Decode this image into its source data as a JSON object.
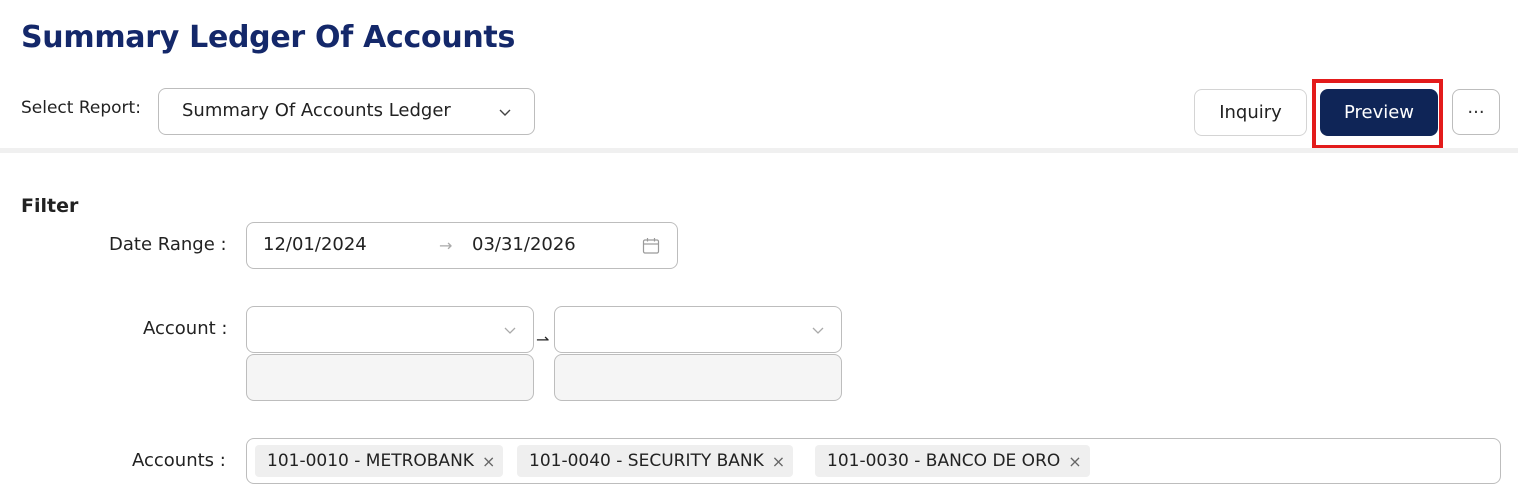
{
  "header": {
    "title": "Summary Ledger Of Accounts"
  },
  "toolbar": {
    "select_report_label": "Select Report:",
    "selected_report": "Summary Of Accounts Ledger",
    "inquiry_label": "Inquiry",
    "preview_label": "Preview",
    "more_label": "···"
  },
  "filter": {
    "title": "Filter",
    "date_range": {
      "label": "Date Range :",
      "from": "12/01/2024",
      "arrow": "→",
      "to": "03/31/2026"
    },
    "account": {
      "label": "Account :",
      "from_value": "",
      "to_value": "",
      "arrow": "⇀"
    },
    "accounts": {
      "label": "Accounts :",
      "tags": [
        "101-0010 - METROBANK",
        "101-0040 - SECURITY BANK",
        "101-0030 - BANCO DE ORO"
      ],
      "remove_glyph": "×"
    }
  },
  "colors": {
    "title": "#14286a",
    "primary_button": "#0f2557",
    "highlight_box": "#e31b1b"
  },
  "icons": {
    "report_dropdown": "chevron-down-icon",
    "date_picker": "calendar-icon",
    "account_dropdown": "chevron-down-icon",
    "tag_remove": "close-icon"
  }
}
